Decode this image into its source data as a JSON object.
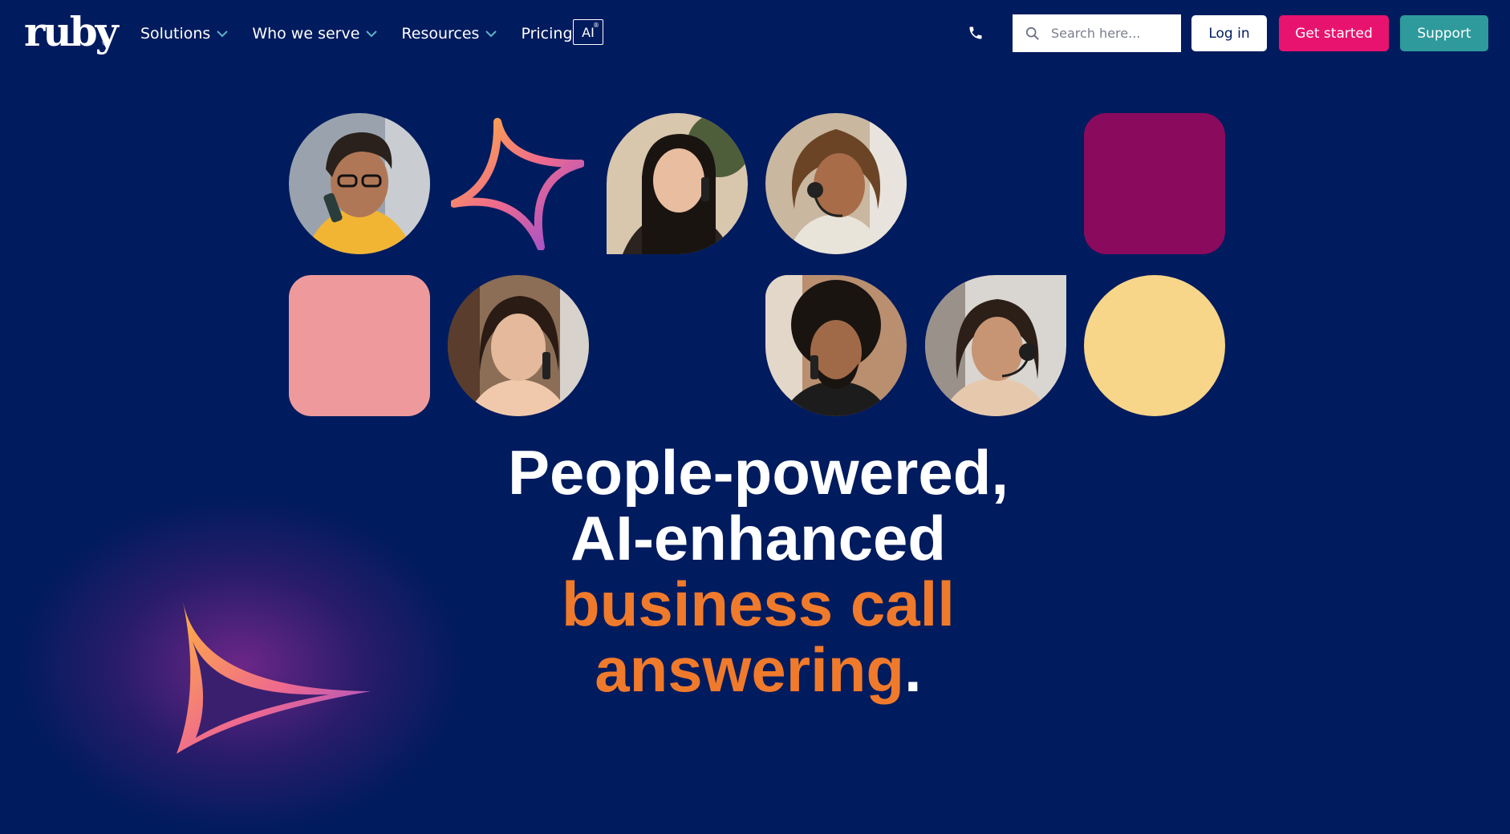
{
  "brand": {
    "logo_text": "ruby",
    "logo_mark": "®"
  },
  "nav": {
    "items": [
      {
        "label": "Solutions",
        "has_dropdown": true
      },
      {
        "label": "Who we serve",
        "has_dropdown": true
      },
      {
        "label": "Resources",
        "has_dropdown": true
      },
      {
        "label": "Pricing",
        "has_dropdown": false
      }
    ],
    "ai_label": "AI",
    "ai_mark": "®"
  },
  "search": {
    "placeholder": "Search here..."
  },
  "actions": {
    "login": "Log in",
    "get_started": "Get started",
    "support": "Support"
  },
  "hero": {
    "line1": "People-powered,",
    "line2": "AI-enhanced",
    "line3": "business call",
    "line4": "answering",
    "line4_suffix": "."
  },
  "colors": {
    "background": "#001b5e",
    "accent_orange": "#f07a2b",
    "get_started": "#e8136f",
    "support": "#2e9a9c",
    "tile_purple": "#8a0a5e",
    "tile_pink": "#ee9a9c",
    "tile_yellow": "#f7d589"
  },
  "icons": {
    "phone": "phone-icon",
    "search": "search-icon",
    "chevron": "chevron-down-icon",
    "sparkle": "sparkle-star-icon"
  }
}
